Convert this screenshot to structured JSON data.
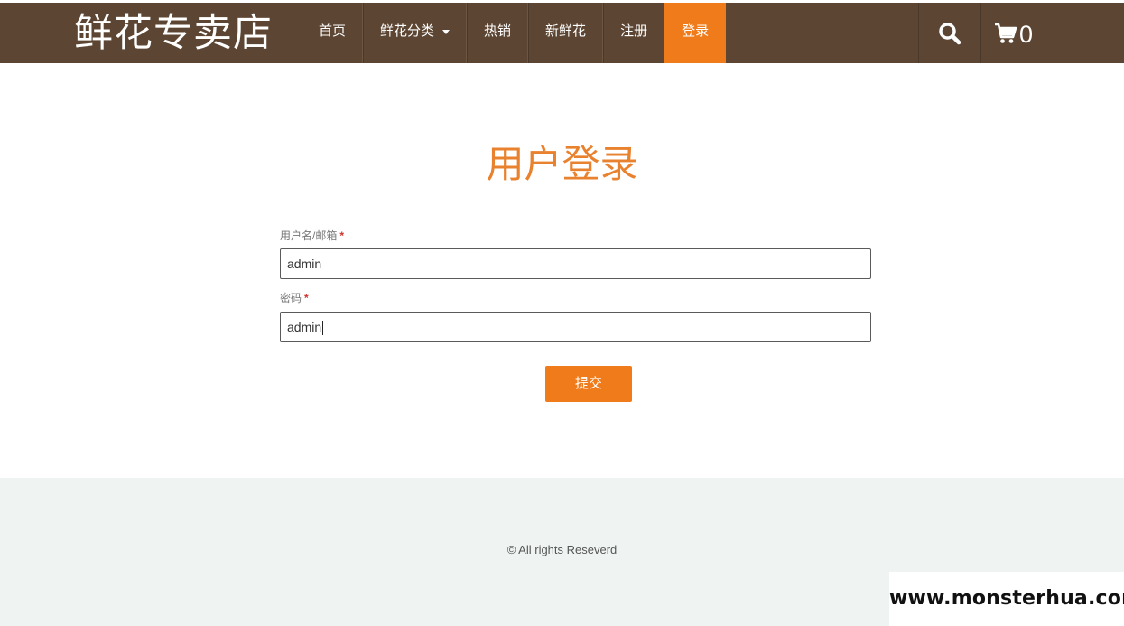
{
  "header": {
    "brand": "鲜花专卖店",
    "nav": [
      {
        "label": "首页"
      },
      {
        "label": "鲜花分类"
      },
      {
        "label": "热销"
      },
      {
        "label": "新鲜花"
      },
      {
        "label": "注册"
      },
      {
        "label": "登录"
      }
    ],
    "active_nav": "登录",
    "cart_count": "0",
    "icons": {
      "search": "search-icon",
      "cart": "cart-icon",
      "dropdown": "caret-down-icon"
    }
  },
  "login": {
    "title": "用户登录",
    "username_label": "用户名/邮箱",
    "username_value": "admin",
    "password_label": "密码",
    "password_value": "admin",
    "required_mark": "*",
    "submit_label": "提交"
  },
  "footer": {
    "copyright": "© All rights Reseverd"
  },
  "watermark": "www.monsterhua.com",
  "colors": {
    "navbar": "#5c4633",
    "accent": "#f07b1b",
    "title": "#e9822e",
    "footer_bg": "#eff4f3"
  }
}
